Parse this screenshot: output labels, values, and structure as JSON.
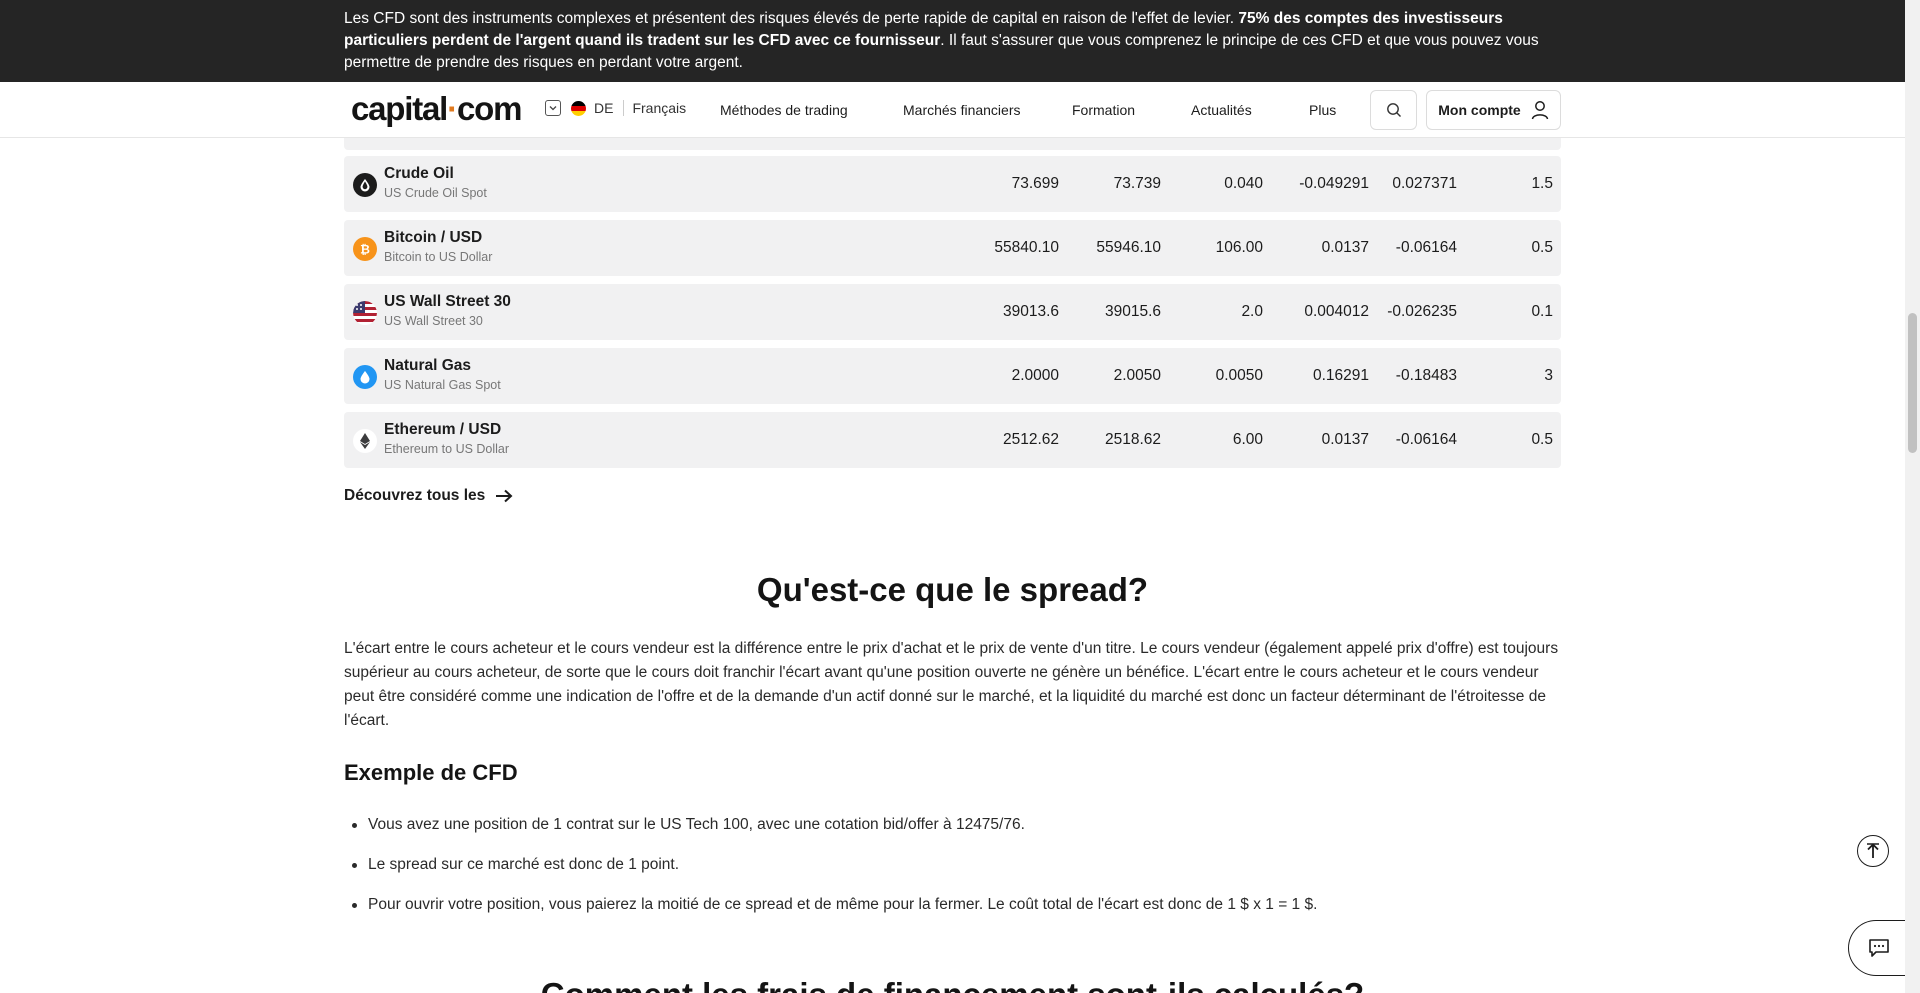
{
  "risk_banner": {
    "text_before": "Les CFD sont des instruments complexes et présentent des risques élevés de perte rapide de capital en raison de l'effet de levier. ",
    "text_bold": "75% des comptes des investisseurs particuliers perdent de l'argent quand ils tradent sur les CFD avec ce fournisseur",
    "text_after": ". Il faut s'assurer que vous comprenez le principe de ces CFD et que vous pouvez vous permettre de prendre des risques en perdant votre argent."
  },
  "header": {
    "logo_main": "capital",
    "logo_dot": "·",
    "logo_end": "com",
    "country": "DE",
    "language": "Français",
    "nav": [
      "Méthodes de trading",
      "Marchés financiers",
      "Formation",
      "Actualités",
      "Plus"
    ],
    "account_label": "Mon compte"
  },
  "markets": [
    {
      "name": "Crude Oil",
      "sub": "US Crude Oil Spot",
      "sell": "73.699",
      "buy": "73.739",
      "spread": "0.040",
      "long": "0.027371",
      "short": "-0.049291",
      "margin": "1.5",
      "icon": "oil-drop-icon",
      "icon_color": "#1c1c1c"
    },
    {
      "name": "Bitcoin / USD",
      "sub": "Bitcoin to US Dollar",
      "sell": "55840.10",
      "buy": "55946.10",
      "spread": "106.00",
      "long": "-0.06164",
      "short": "0.0137",
      "margin": "0.5",
      "icon": "bitcoin-icon",
      "icon_color": "#f7931a"
    },
    {
      "name": "US Wall Street 30",
      "sub": "US Wall Street 30",
      "sell": "39013.6",
      "buy": "39015.6",
      "spread": "2.0",
      "long": "-0.026235",
      "short": "0.004012",
      "margin": "0.1",
      "icon": "us-flag-icon",
      "icon_color": "#b22234"
    },
    {
      "name": "Natural Gas",
      "sub": "US Natural Gas Spot",
      "sell": "2.0000",
      "buy": "2.0050",
      "spread": "0.0050",
      "long": "-0.18483",
      "short": "0.16291",
      "margin": "3",
      "icon": "gas-flame-icon",
      "icon_color": "#2196f3"
    },
    {
      "name": "Ethereum / USD",
      "sub": "Ethereum to US Dollar",
      "sell": "2512.62",
      "buy": "2518.62",
      "spread": "6.00",
      "long": "-0.06164",
      "short": "0.0137",
      "margin": "0.5",
      "icon": "ethereum-icon",
      "icon_color": "#3c3c3d"
    }
  ],
  "discover_label": "Découvrez tous les",
  "spread_section": {
    "title": "Qu'est-ce que le spread?",
    "paragraph": "L'écart entre le cours acheteur et le cours vendeur est la différence entre le prix d'achat et le prix de vente d'un titre. Le cours vendeur (également appelé prix d'offre) est toujours supérieur au cours acheteur, de sorte que le cours doit franchir l'écart avant qu'une position ouverte ne génère un bénéfice. L'écart entre le cours acheteur et le cours vendeur peut être considéré comme une indication de l'offre et de la demande d'un actif donné sur le marché, et la liquidité du marché est donc un facteur déterminant de l'étroitesse de l'écart.",
    "example_title": "Exemple de CFD",
    "bullets": [
      "Vous avez une position de 1 contrat sur le US Tech 100, avec une cotation bid/offer à 12475/76.",
      "Le spread sur ce marché est donc de 1 point.",
      "Pour ouvrir votre position, vous paierez la moitié de ce spread et de même pour la fermer. Le coût total de l'écart est donc de 1 $ x 1 = 1 $."
    ],
    "next_title": "Comment les frais de financement sont-ils calculés?"
  }
}
